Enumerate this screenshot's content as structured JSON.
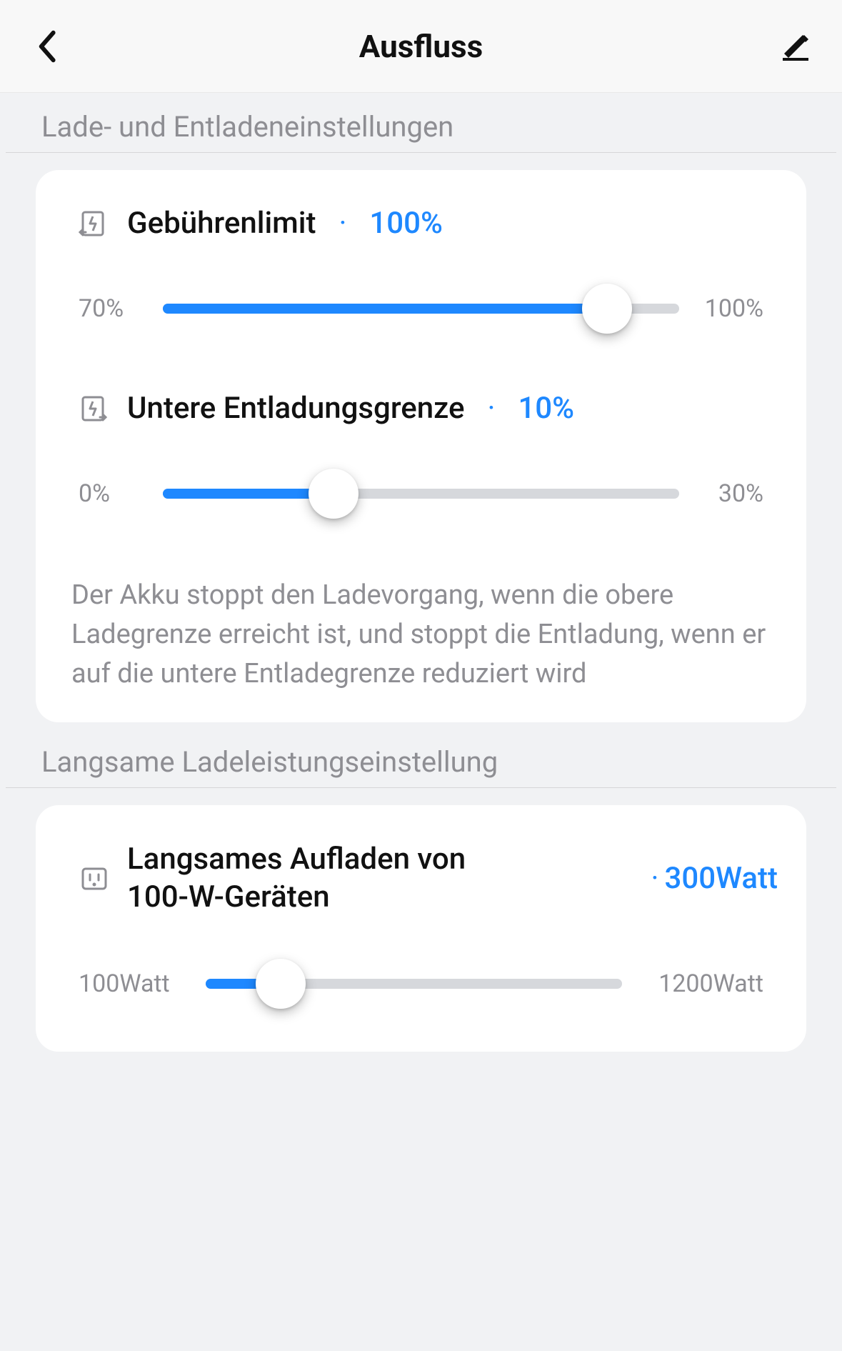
{
  "header": {
    "title": "Ausfluss"
  },
  "section1": {
    "heading": "Lade- und Entladeneinstellungen",
    "charge_limit": {
      "label": "Gebührenlimit",
      "value": "100%",
      "min_label": "70%",
      "max_label": "100%",
      "fill_pct": 86,
      "thumb_pct": 86
    },
    "discharge_limit": {
      "label": "Untere Entladungsgrenze",
      "value": "10%",
      "min_label": "0%",
      "max_label": "30%",
      "fill_pct": 33,
      "thumb_pct": 33
    },
    "description": "Der Akku stoppt den Ladevorgang, wenn die obere Ladegrenze erreicht ist, und stoppt die Entladung, wenn er auf die untere Entladegrenze reduziert wird"
  },
  "section2": {
    "heading": "Langsame Ladeleistungseinstellung",
    "slow_charge": {
      "label": "Langsames Aufladen von 100-W-Geräten",
      "value": "300Watt",
      "min_label": "100Watt",
      "max_label": "1200Watt",
      "fill_pct": 18,
      "thumb_pct": 18
    }
  }
}
